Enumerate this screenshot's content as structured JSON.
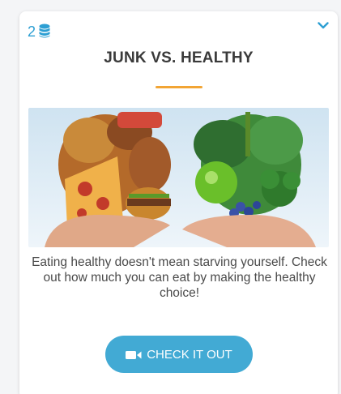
{
  "card": {
    "badge_count": "2",
    "badge_icon": "coin-stack-icon",
    "toggle_icon": "chevron-down-icon",
    "title": "JUNK VS. HEALTHY",
    "description": "Eating healthy doesn't mean starving yourself. Check out how much you can eat by making the healthy choice!",
    "cta_label": "CHECK IT OUT",
    "cta_icon": "video-camera-icon"
  },
  "colors": {
    "accent": "#2d9fd3",
    "button": "#42aad4",
    "title_rule": "#f2a535",
    "title_text": "#3a3a3a"
  }
}
